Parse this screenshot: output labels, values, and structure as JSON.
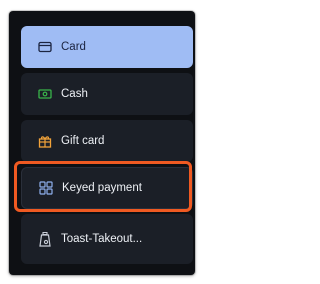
{
  "payment_options": [
    {
      "label": "Card",
      "icon": "credit-card-icon",
      "selected": true
    },
    {
      "label": "Cash",
      "icon": "cash-icon",
      "selected": false
    },
    {
      "label": "Gift card",
      "icon": "gift-icon",
      "selected": false
    },
    {
      "label": "Keyed payment",
      "icon": "grid-icon",
      "selected": false
    },
    {
      "label": "Toast-Takeout...",
      "icon": "takeout-bag-icon",
      "selected": false
    }
  ],
  "colors": {
    "selected_background": "#9fbcf4",
    "option_background": "#1b1f27",
    "panel_background": "#0e1014",
    "highlight_outline": "#f05a22",
    "cash_icon": "#39b54a",
    "gift_icon": "#f2a33a"
  }
}
